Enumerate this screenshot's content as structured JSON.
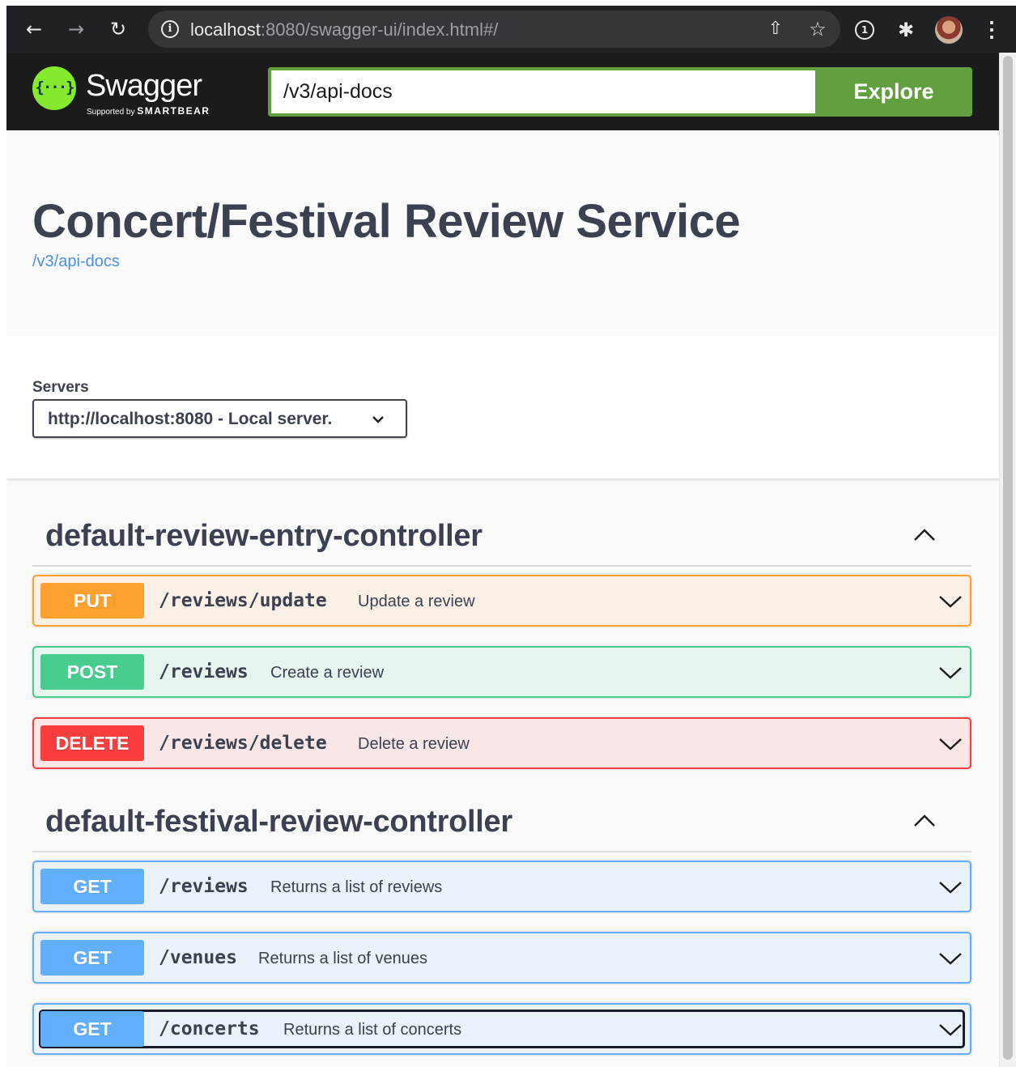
{
  "browser": {
    "url_host": "localhost",
    "url_rest": ":8080/swagger-ui/index.html#/",
    "icons": [
      "arrow-back-icon",
      "arrow-forward-icon",
      "reload-icon",
      "info-icon",
      "share-icon",
      "star-icon",
      "password-manager-icon",
      "puzzle-icon",
      "avatar",
      "menu-dots-icon"
    ]
  },
  "topbar": {
    "logo_text": "Swagger",
    "logo_sub_small": "Supported by",
    "logo_sub_brand": "SMARTBEAR",
    "url_value": "/v3/api-docs",
    "explore_label": "Explore"
  },
  "info": {
    "title": "Concert/Festival Review Service",
    "spec_link": "/v3/api-docs"
  },
  "servers": {
    "label": "Servers",
    "selected": "http://localhost:8080 - Local server."
  },
  "colors": {
    "put": "#fca130",
    "post": "#49cc90",
    "delete": "#f93e3e",
    "get": "#61affe",
    "explore": "#62a03f",
    "link": "#4990e2"
  },
  "tags": [
    {
      "name": "default-review-entry-controller",
      "operations": [
        {
          "method": "PUT",
          "path": "/reviews/update",
          "summary": "Update a review"
        },
        {
          "method": "POST",
          "path": "/reviews",
          "summary": "Create a review"
        },
        {
          "method": "DELETE",
          "path": "/reviews/delete",
          "summary": "Delete a review"
        }
      ]
    },
    {
      "name": "default-festival-review-controller",
      "operations": [
        {
          "method": "GET",
          "path": "/reviews",
          "summary": "Returns a list of reviews"
        },
        {
          "method": "GET",
          "path": "/venues",
          "summary": "Returns a list of venues"
        },
        {
          "method": "GET",
          "path": "/concerts",
          "summary": "Returns a list of concerts"
        }
      ]
    }
  ]
}
